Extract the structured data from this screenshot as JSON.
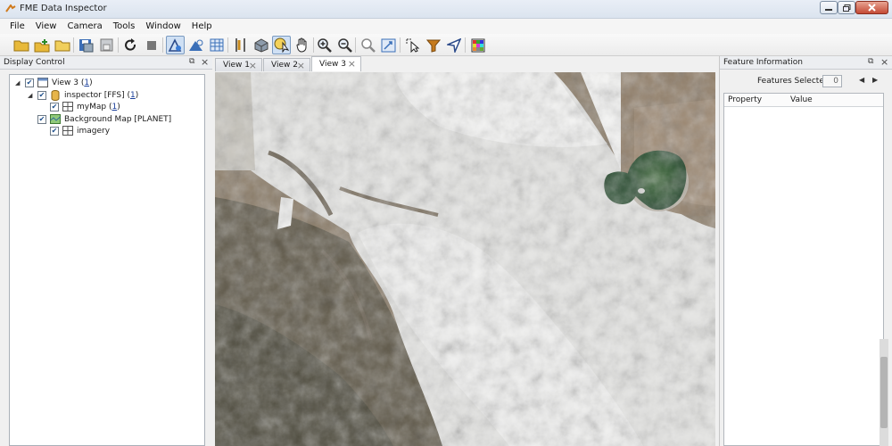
{
  "window": {
    "title": "FME Data Inspector"
  },
  "menu": [
    "File",
    "View",
    "Camera",
    "Tools",
    "Window",
    "Help"
  ],
  "toolbar": {
    "icons": [
      "open-folder-icon",
      "add-data-icon",
      "folder-icon",
      "save-icon",
      "export-icon",
      "refresh-icon",
      "stop-icon",
      "draw-style-icon",
      "background-map-icon",
      "table-view-icon",
      "measure-icon",
      "3d-view-icon",
      "identify-icon",
      "pan-icon",
      "zoom-in-icon",
      "zoom-out-icon",
      "zoom-feature-icon",
      "zoom-extent-icon",
      "select-icon",
      "filter-icon",
      "navigate-icon",
      "color-grid-icon"
    ]
  },
  "display_control": {
    "title": "Display Control",
    "tree": [
      {
        "label": "View 3",
        "count": "1",
        "level": 0,
        "icon": "view-icon"
      },
      {
        "label": "inspector [FFS]",
        "count": "1",
        "level": 1,
        "icon": "dataset-icon"
      },
      {
        "label": "myMap",
        "count": "1",
        "level": 2,
        "icon": "raster-icon"
      },
      {
        "label": "Background Map [PLANET]",
        "count": "",
        "level": 1,
        "icon": "basemap-icon"
      },
      {
        "label": "imagery",
        "count": "",
        "level": 2,
        "icon": "raster-icon"
      }
    ]
  },
  "tabs": [
    {
      "label": "View 1",
      "active": false
    },
    {
      "label": "View 2",
      "active": false
    },
    {
      "label": "View 3",
      "active": true
    }
  ],
  "feature_info": {
    "title": "Feature Information",
    "features_selected_label": "Features Selected:",
    "features_selected_value": "0",
    "columns": [
      "Property",
      "Value"
    ]
  }
}
